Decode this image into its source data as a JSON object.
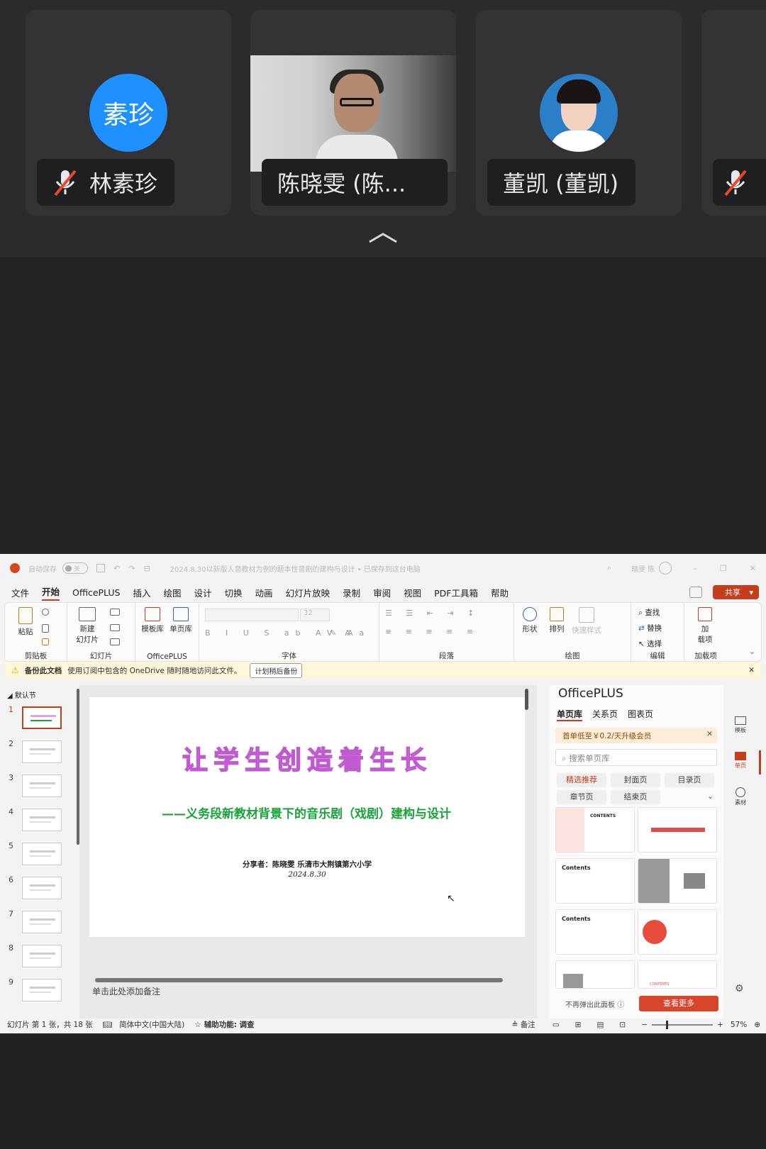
{
  "meeting": {
    "participants": [
      {
        "avatar_text": "素珍",
        "name": "林素珍",
        "muted": true
      },
      {
        "name": "陈晓雯 (陈..."
      },
      {
        "name": "董凯 (董凯)"
      },
      {
        "muted": true
      }
    ]
  },
  "ppt": {
    "titlebar": {
      "autosave": "自动保存",
      "autosave_state": "关",
      "doc_title": "2024.8.30以新版人音教材为例的题本性音剧的建构与设计 • 已保存到这台电脑",
      "user": "晓雯 陈"
    },
    "menu": [
      "文件",
      "开始",
      "OfficePLUS",
      "插入",
      "绘图",
      "设计",
      "切换",
      "动画",
      "幻灯片放映",
      "录制",
      "审阅",
      "视图",
      "PDF工具箱",
      "帮助"
    ],
    "menu_active_index": 1,
    "share_label": "共享",
    "ribbon": {
      "paste": "粘贴",
      "clipboard": "剪贴板",
      "new_slide": "新建\n幻灯片",
      "slides": "幻灯片",
      "template_lib": "模板库",
      "single_lib": "单页库",
      "officeplus": "OfficePLUS",
      "font_size": "32",
      "font": "字体",
      "paragraph": "段落",
      "shape": "形状",
      "arrange": "排列",
      "quick_style": "快速样式",
      "drawing": "绘图",
      "find": "查找",
      "replace": "替换",
      "select": "选择",
      "editing": "编辑",
      "addins_btn": "加\n载项",
      "addins": "加载项"
    },
    "infobar": {
      "title": "备份此文档",
      "message": "使用订阅中包含的 OneDrive 随时随地访问此文件。",
      "button": "计划稍后备份"
    },
    "section": "默认节",
    "slide_count": 9,
    "slide_numbers": [
      "1",
      "2",
      "3",
      "4",
      "5",
      "6",
      "7",
      "8",
      "9"
    ],
    "slide": {
      "title": "让学生创造着生长",
      "subtitle": "——义务段新教材背景下的音乐剧（戏剧）建构与设计",
      "author": "分享者：陈晓雯 乐清市大荆镇第六小学",
      "date": "2024.8.30"
    },
    "notes_placeholder": "单击此处添加备注",
    "pane": {
      "title": "OfficePLUS",
      "tabs": [
        "单页库",
        "关系页",
        "图表页"
      ],
      "promo": "首单低至￥0.2/天升级会员",
      "search_placeholder": "搜索单页库",
      "chips": [
        "精选推荐",
        "封面页",
        "目录页",
        "章节页",
        "结束页"
      ],
      "dont_show": "不再弹出此面板",
      "more_button": "查看更多",
      "card_labels": [
        "CONTENTS",
        "Contents",
        "Contents",
        "CONTENTS"
      ]
    },
    "rail": [
      "模板",
      "单页",
      "素材"
    ],
    "status": {
      "slide_info": "幻灯片 第 1 张，共 18 张",
      "language": "简体中文(中国大陆)",
      "accessibility": "辅助功能: 调查",
      "notes": "备注",
      "zoom": "57%"
    },
    "colors": {
      "accent": "#c43e1c",
      "slide_title": "#f4a7e8",
      "slide_subtitle": "#19a33a",
      "avatar": "#1e90ff"
    }
  }
}
